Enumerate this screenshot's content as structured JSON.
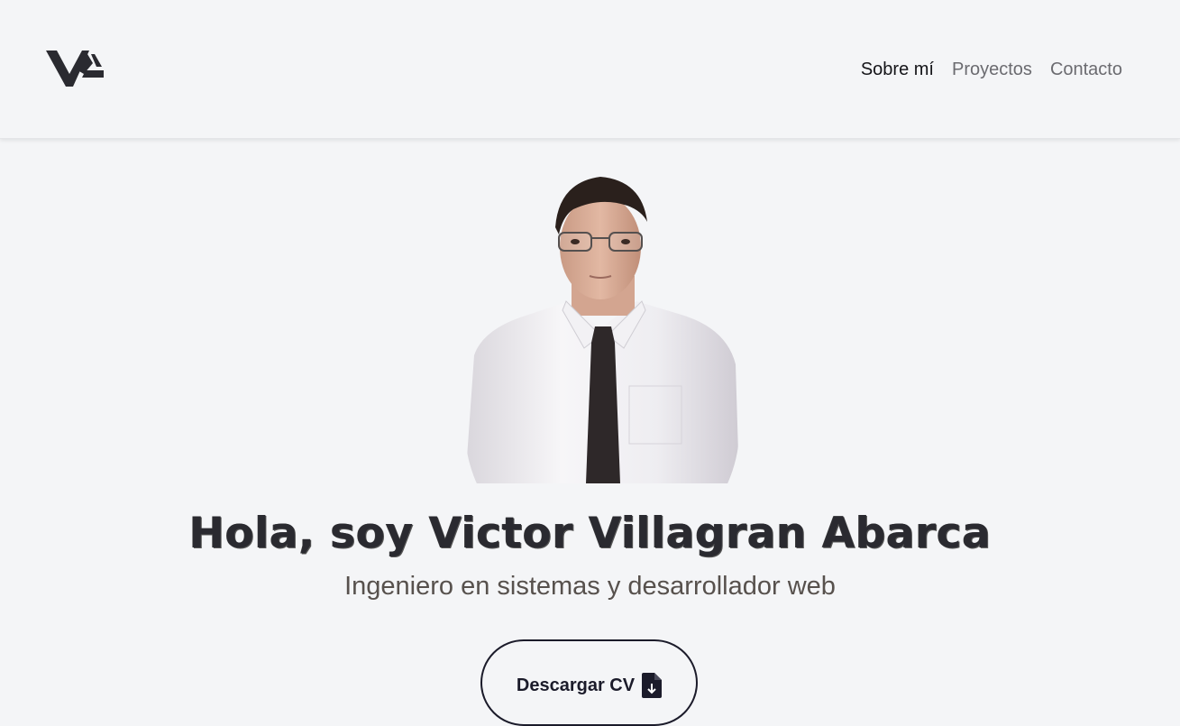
{
  "header": {
    "logo_alt": "VA logo",
    "nav": [
      {
        "label": "Sobre mí",
        "active": true
      },
      {
        "label": "Proyectos",
        "active": false
      },
      {
        "label": "Contacto",
        "active": false
      }
    ]
  },
  "hero": {
    "title": "Hola, soy Victor Villagran Abarca",
    "subtitle": "Ingeniero en sistemas y desarrollador web",
    "cv_button_label": "Descargar CV",
    "cv_button_icon": "file-download-icon"
  },
  "colors": {
    "background": "#f4f5f7",
    "text_dark": "#141418",
    "text_muted": "#6b6b70",
    "accent": "#1b1b2a"
  }
}
